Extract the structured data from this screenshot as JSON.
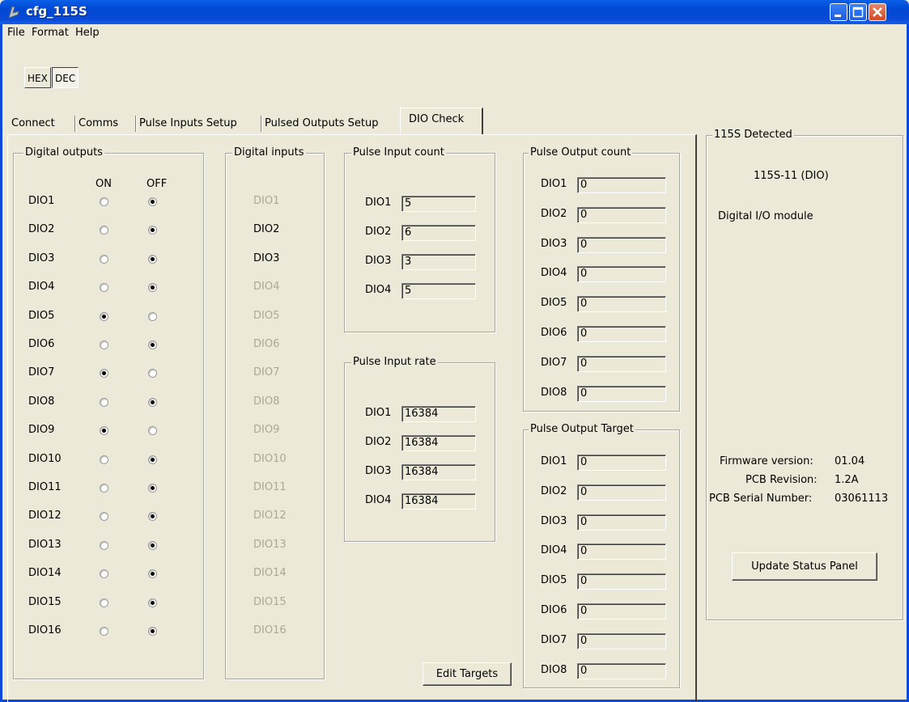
{
  "window": {
    "title": "cfg_115S"
  },
  "menu": [
    "File",
    "Format",
    "Help"
  ],
  "format_toggle": {
    "hex_label": "HEX",
    "dec_label": "DEC",
    "selected": "DEC"
  },
  "tabs": [
    "Connect",
    "Comms",
    "Pulse Inputs Setup",
    "Pulsed Outputs Setup",
    "DIO Check"
  ],
  "active_tab": "DIO Check",
  "digital_outputs": {
    "title": "Digital outputs",
    "on_label": "ON",
    "off_label": "OFF",
    "rows": [
      {
        "label": "DIO1",
        "state": "OFF"
      },
      {
        "label": "DIO2",
        "state": "OFF"
      },
      {
        "label": "DIO3",
        "state": "OFF"
      },
      {
        "label": "DIO4",
        "state": "OFF"
      },
      {
        "label": "DIO5",
        "state": "ON"
      },
      {
        "label": "DIO6",
        "state": "OFF"
      },
      {
        "label": "DIO7",
        "state": "ON"
      },
      {
        "label": "DIO8",
        "state": "OFF"
      },
      {
        "label": "DIO9",
        "state": "ON"
      },
      {
        "label": "DIO10",
        "state": "OFF"
      },
      {
        "label": "DIO11",
        "state": "OFF"
      },
      {
        "label": "DIO12",
        "state": "OFF"
      },
      {
        "label": "DIO13",
        "state": "OFF"
      },
      {
        "label": "DIO14",
        "state": "OFF"
      },
      {
        "label": "DIO15",
        "state": "OFF"
      },
      {
        "label": "DIO16",
        "state": "OFF"
      }
    ]
  },
  "digital_inputs": {
    "title": "Digital inputs",
    "rows": [
      {
        "label": "DIO1",
        "active": false
      },
      {
        "label": "DIO2",
        "active": true
      },
      {
        "label": "DIO3",
        "active": true
      },
      {
        "label": "DIO4",
        "active": false
      },
      {
        "label": "DIO5",
        "active": false
      },
      {
        "label": "DIO6",
        "active": false
      },
      {
        "label": "DIO7",
        "active": false
      },
      {
        "label": "DIO8",
        "active": false
      },
      {
        "label": "DIO9",
        "active": false
      },
      {
        "label": "DIO10",
        "active": false
      },
      {
        "label": "DIO11",
        "active": false
      },
      {
        "label": "DIO12",
        "active": false
      },
      {
        "label": "DIO13",
        "active": false
      },
      {
        "label": "DIO14",
        "active": false
      },
      {
        "label": "DIO15",
        "active": false
      },
      {
        "label": "DIO16",
        "active": false
      }
    ]
  },
  "pulse_input_count": {
    "title": "Pulse Input count",
    "rows": [
      {
        "label": "DIO1",
        "value": "5"
      },
      {
        "label": "DIO2",
        "value": "6"
      },
      {
        "label": "DIO3",
        "value": "3"
      },
      {
        "label": "DIO4",
        "value": "5"
      }
    ]
  },
  "pulse_input_rate": {
    "title": "Pulse Input rate",
    "rows": [
      {
        "label": "DIO1",
        "value": "16384"
      },
      {
        "label": "DIO2",
        "value": "16384"
      },
      {
        "label": "DIO3",
        "value": "16384"
      },
      {
        "label": "DIO4",
        "value": "16384"
      }
    ]
  },
  "pulse_output_count": {
    "title": "Pulse Output count",
    "rows": [
      {
        "label": "DIO1",
        "value": "0"
      },
      {
        "label": "DIO2",
        "value": "0"
      },
      {
        "label": "DIO3",
        "value": "0"
      },
      {
        "label": "DIO4",
        "value": "0"
      },
      {
        "label": "DIO5",
        "value": "0"
      },
      {
        "label": "DIO6",
        "value": "0"
      },
      {
        "label": "DIO7",
        "value": "0"
      },
      {
        "label": "DIO8",
        "value": "0"
      }
    ]
  },
  "pulse_output_target": {
    "title": "Pulse Output Target",
    "rows": [
      {
        "label": "DIO1",
        "value": "0"
      },
      {
        "label": "DIO2",
        "value": "0"
      },
      {
        "label": "DIO3",
        "value": "0"
      },
      {
        "label": "DIO4",
        "value": "0"
      },
      {
        "label": "DIO5",
        "value": "0"
      },
      {
        "label": "DIO6",
        "value": "0"
      },
      {
        "label": "DIO7",
        "value": "0"
      },
      {
        "label": "DIO8",
        "value": "0"
      }
    ]
  },
  "edit_targets_label": "Edit Targets",
  "status_panel": {
    "title": "115S Detected",
    "model": "115S-11 (DIO)",
    "description": "Digital I/O module",
    "firmware_label": "Firmware version:",
    "firmware_value": "01.04",
    "pcb_revision_label": "PCB Revision:",
    "pcb_revision_value": "1.2A",
    "serial_label": "PCB Serial Number:",
    "serial_value": "03061113",
    "update_button_label": "Update Status Panel"
  }
}
